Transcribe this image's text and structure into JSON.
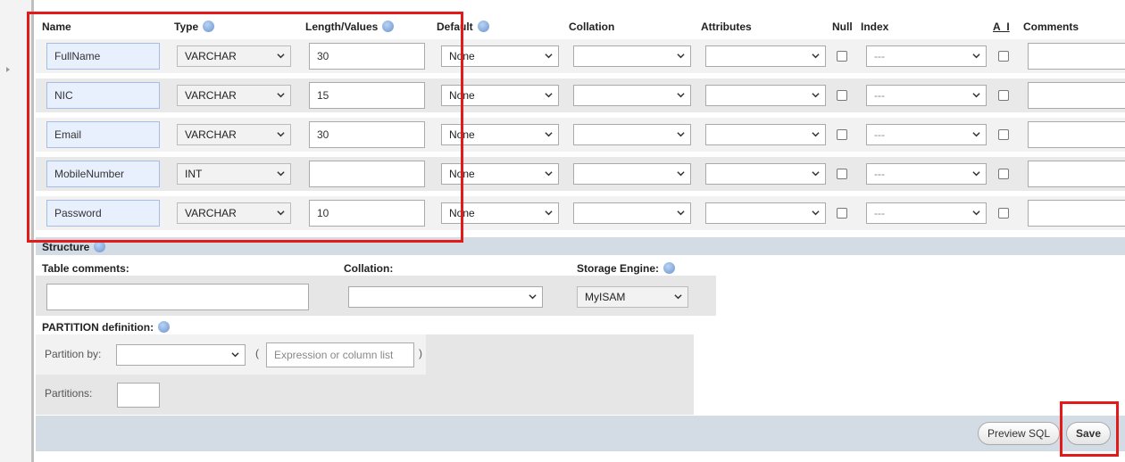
{
  "columns": {
    "name": "Name",
    "type": "Type",
    "length": "Length/Values",
    "default": "Default",
    "collation": "Collation",
    "attributes": "Attributes",
    "null": "Null",
    "index": "Index",
    "ai": "A_I",
    "comments": "Comments"
  },
  "rows": [
    {
      "name": "FullName",
      "type": "VARCHAR",
      "length": "30",
      "default": "None",
      "index": "---"
    },
    {
      "name": "NIC",
      "type": "VARCHAR",
      "length": "15",
      "default": "None",
      "index": "---"
    },
    {
      "name": "Email",
      "type": "VARCHAR",
      "length": "30",
      "default": "None",
      "index": "---"
    },
    {
      "name": "MobileNumber",
      "type": "INT",
      "length": "",
      "default": "None",
      "index": "---"
    },
    {
      "name": "Password",
      "type": "VARCHAR",
      "length": "10",
      "default": "None",
      "index": "---"
    }
  ],
  "structure": {
    "title": "Structure",
    "table_comments_label": "Table comments:",
    "collation_label": "Collation:",
    "storage_engine_label": "Storage Engine:",
    "storage_engine_value": "MyISAM"
  },
  "partition": {
    "title": "PARTITION definition:",
    "by_label": "Partition by:",
    "expression_placeholder": "Expression or column list",
    "open_paren": "(",
    "close_paren": ")",
    "partitions_label": "Partitions:"
  },
  "footer": {
    "preview_sql": "Preview SQL",
    "save": "Save"
  },
  "colors": {
    "highlight_box": "#e21a1a",
    "name_input_bg": "#e8f0fe",
    "footer_bar": "#d3dce5"
  }
}
